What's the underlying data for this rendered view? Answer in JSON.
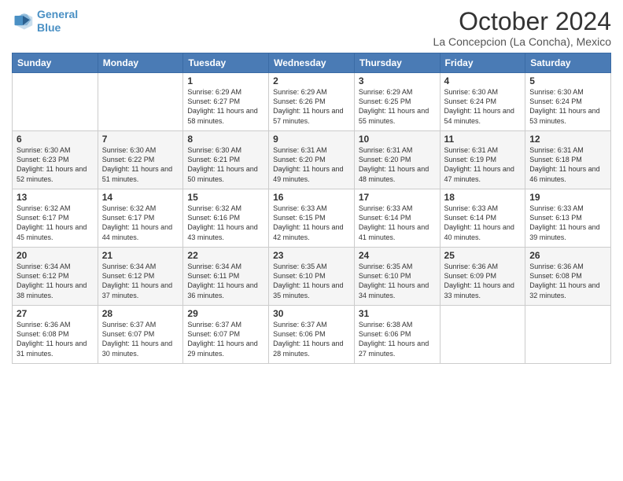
{
  "logo": {
    "line1": "General",
    "line2": "Blue"
  },
  "title": "October 2024",
  "subtitle": "La Concepcion (La Concha), Mexico",
  "weekdays": [
    "Sunday",
    "Monday",
    "Tuesday",
    "Wednesday",
    "Thursday",
    "Friday",
    "Saturday"
  ],
  "weeks": [
    [
      {
        "day": "",
        "info": ""
      },
      {
        "day": "",
        "info": ""
      },
      {
        "day": "1",
        "info": "Sunrise: 6:29 AM\nSunset: 6:27 PM\nDaylight: 11 hours and 58 minutes."
      },
      {
        "day": "2",
        "info": "Sunrise: 6:29 AM\nSunset: 6:26 PM\nDaylight: 11 hours and 57 minutes."
      },
      {
        "day": "3",
        "info": "Sunrise: 6:29 AM\nSunset: 6:25 PM\nDaylight: 11 hours and 55 minutes."
      },
      {
        "day": "4",
        "info": "Sunrise: 6:30 AM\nSunset: 6:24 PM\nDaylight: 11 hours and 54 minutes."
      },
      {
        "day": "5",
        "info": "Sunrise: 6:30 AM\nSunset: 6:24 PM\nDaylight: 11 hours and 53 minutes."
      }
    ],
    [
      {
        "day": "6",
        "info": "Sunrise: 6:30 AM\nSunset: 6:23 PM\nDaylight: 11 hours and 52 minutes."
      },
      {
        "day": "7",
        "info": "Sunrise: 6:30 AM\nSunset: 6:22 PM\nDaylight: 11 hours and 51 minutes."
      },
      {
        "day": "8",
        "info": "Sunrise: 6:30 AM\nSunset: 6:21 PM\nDaylight: 11 hours and 50 minutes."
      },
      {
        "day": "9",
        "info": "Sunrise: 6:31 AM\nSunset: 6:20 PM\nDaylight: 11 hours and 49 minutes."
      },
      {
        "day": "10",
        "info": "Sunrise: 6:31 AM\nSunset: 6:20 PM\nDaylight: 11 hours and 48 minutes."
      },
      {
        "day": "11",
        "info": "Sunrise: 6:31 AM\nSunset: 6:19 PM\nDaylight: 11 hours and 47 minutes."
      },
      {
        "day": "12",
        "info": "Sunrise: 6:31 AM\nSunset: 6:18 PM\nDaylight: 11 hours and 46 minutes."
      }
    ],
    [
      {
        "day": "13",
        "info": "Sunrise: 6:32 AM\nSunset: 6:17 PM\nDaylight: 11 hours and 45 minutes."
      },
      {
        "day": "14",
        "info": "Sunrise: 6:32 AM\nSunset: 6:17 PM\nDaylight: 11 hours and 44 minutes."
      },
      {
        "day": "15",
        "info": "Sunrise: 6:32 AM\nSunset: 6:16 PM\nDaylight: 11 hours and 43 minutes."
      },
      {
        "day": "16",
        "info": "Sunrise: 6:33 AM\nSunset: 6:15 PM\nDaylight: 11 hours and 42 minutes."
      },
      {
        "day": "17",
        "info": "Sunrise: 6:33 AM\nSunset: 6:14 PM\nDaylight: 11 hours and 41 minutes."
      },
      {
        "day": "18",
        "info": "Sunrise: 6:33 AM\nSunset: 6:14 PM\nDaylight: 11 hours and 40 minutes."
      },
      {
        "day": "19",
        "info": "Sunrise: 6:33 AM\nSunset: 6:13 PM\nDaylight: 11 hours and 39 minutes."
      }
    ],
    [
      {
        "day": "20",
        "info": "Sunrise: 6:34 AM\nSunset: 6:12 PM\nDaylight: 11 hours and 38 minutes."
      },
      {
        "day": "21",
        "info": "Sunrise: 6:34 AM\nSunset: 6:12 PM\nDaylight: 11 hours and 37 minutes."
      },
      {
        "day": "22",
        "info": "Sunrise: 6:34 AM\nSunset: 6:11 PM\nDaylight: 11 hours and 36 minutes."
      },
      {
        "day": "23",
        "info": "Sunrise: 6:35 AM\nSunset: 6:10 PM\nDaylight: 11 hours and 35 minutes."
      },
      {
        "day": "24",
        "info": "Sunrise: 6:35 AM\nSunset: 6:10 PM\nDaylight: 11 hours and 34 minutes."
      },
      {
        "day": "25",
        "info": "Sunrise: 6:36 AM\nSunset: 6:09 PM\nDaylight: 11 hours and 33 minutes."
      },
      {
        "day": "26",
        "info": "Sunrise: 6:36 AM\nSunset: 6:08 PM\nDaylight: 11 hours and 32 minutes."
      }
    ],
    [
      {
        "day": "27",
        "info": "Sunrise: 6:36 AM\nSunset: 6:08 PM\nDaylight: 11 hours and 31 minutes."
      },
      {
        "day": "28",
        "info": "Sunrise: 6:37 AM\nSunset: 6:07 PM\nDaylight: 11 hours and 30 minutes."
      },
      {
        "day": "29",
        "info": "Sunrise: 6:37 AM\nSunset: 6:07 PM\nDaylight: 11 hours and 29 minutes."
      },
      {
        "day": "30",
        "info": "Sunrise: 6:37 AM\nSunset: 6:06 PM\nDaylight: 11 hours and 28 minutes."
      },
      {
        "day": "31",
        "info": "Sunrise: 6:38 AM\nSunset: 6:06 PM\nDaylight: 11 hours and 27 minutes."
      },
      {
        "day": "",
        "info": ""
      },
      {
        "day": "",
        "info": ""
      }
    ]
  ]
}
